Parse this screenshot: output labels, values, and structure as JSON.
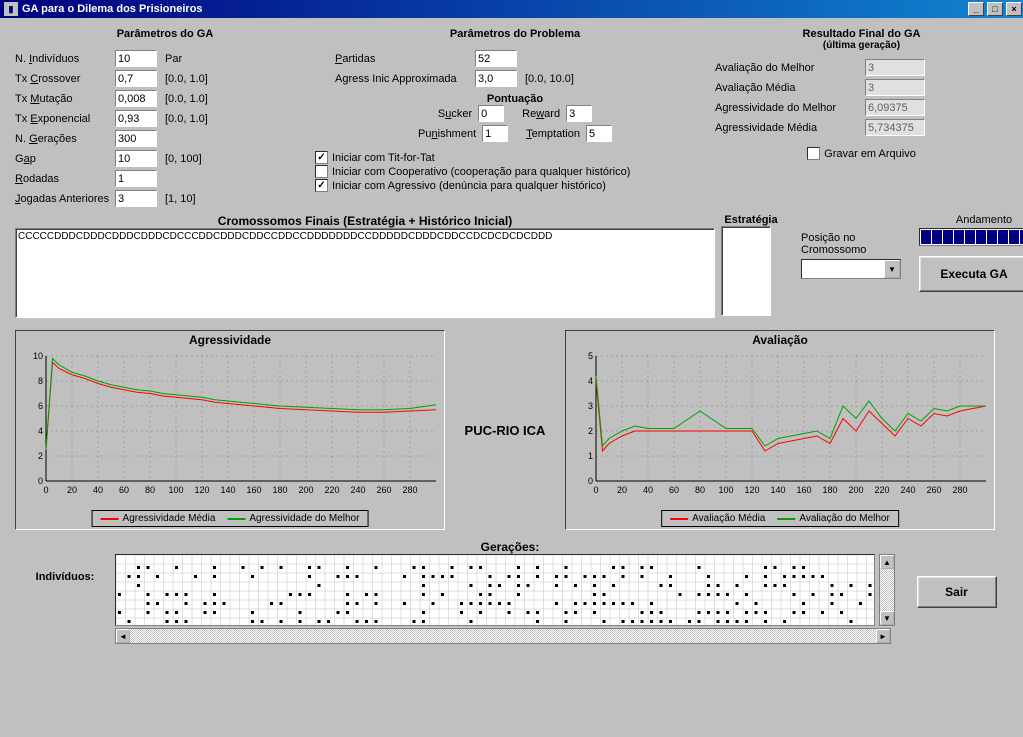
{
  "window": {
    "title": "GA para o Dilema dos Prisioneiros"
  },
  "ga_params": {
    "title": "Parâmetros do GA",
    "individuos_label": "N. Indivíduos",
    "individuos_value": "10",
    "individuos_hint": "Par",
    "crossover_label": "Tx Crossover",
    "crossover_value": "0,7",
    "crossover_range": "[0.0, 1.0]",
    "mutacao_label": "Tx Mutação",
    "mutacao_value": "0,008",
    "mutacao_range": "[0.0, 1.0]",
    "exp_label": "Tx Exponencial",
    "exp_value": "0,93",
    "exp_range": "[0.0, 1.0]",
    "geracoes_label": "N. Gerações",
    "geracoes_value": "300",
    "gap_label": "Gap",
    "gap_value": "10",
    "gap_range": "[0, 100]",
    "rodadas_label": "Rodadas",
    "rodadas_value": "1",
    "jogadas_label": "Jogadas Anteriores",
    "jogadas_value": "3",
    "jogadas_range": "[1, 10]"
  },
  "prob_params": {
    "title": "Parâmetros do Problema",
    "partidas_label": "Partidas",
    "partidas_value": "52",
    "agress_label": "Agress Inic Approximada",
    "agress_value": "3,0",
    "agress_range": "[0.0, 10.0]",
    "pontuacao_title": "Pontuação",
    "sucker_label": "Sucker",
    "sucker_value": "0",
    "reward_label": "Reward",
    "reward_value": "3",
    "punishment_label": "Punishment",
    "punishment_value": "1",
    "temptation_label": "Temptation",
    "temptation_value": "5",
    "titfortat_label": "Iniciar com Tit-for-Tat",
    "titfortat_checked": true,
    "coop_label": "Iniciar com Cooperativo (cooperação para qualquer histórico)",
    "coop_checked": false,
    "agressivo_label": "Iniciar com Agressivo (denúncia para qualquer histórico)",
    "agressivo_checked": true
  },
  "results": {
    "title": "Resultado Final do GA",
    "subtitle": "(última geração)",
    "aval_melhor_label": "Avaliação do Melhor",
    "aval_melhor_value": "3",
    "aval_media_label": "Avaliação Média",
    "aval_media_value": "3",
    "agress_melhor_label": "Agressividade do Melhor",
    "agress_melhor_value": "6,09375",
    "agress_media_label": "Agressividade Média",
    "agress_media_value": "5,734375",
    "gravar_label": "Gravar em Arquivo",
    "gravar_checked": false
  },
  "cromossomos": {
    "title": "Cromossomos Finais (Estratégia + Histórico Inicial)",
    "content": "CCCCCDDDCDDDCDDDCDDDCDCCCDDCDDDCDDCCDDCCDDDDDDDCCDDDDDCDDDCDDCCDCDCDCDCDDD",
    "estrategia_label": "Estratégia",
    "posicao_label": "Posição no Cromossomo",
    "andamento_label": "Andamento",
    "executa_label": "Executa GA"
  },
  "charts": {
    "center_label": "PUC-RIO ICA",
    "agress_title": "Agressividade",
    "agress_leg1": "Agressividade Média",
    "agress_leg2": "Agressividade do Melhor",
    "aval_title": "Avaliação",
    "aval_leg1": "Avaliação Média",
    "aval_leg2": "Avaliação do Melhor"
  },
  "bottom": {
    "geracoes_label": "Gerações:",
    "individuos_label": "Indivíduos:",
    "sair_label": "Sair"
  },
  "chart_data": [
    {
      "type": "line",
      "title": "Agressividade",
      "xlabel": "",
      "ylabel": "",
      "xlim": [
        0,
        300
      ],
      "ylim": [
        0,
        10
      ],
      "x_ticks": [
        0,
        20,
        40,
        60,
        80,
        100,
        120,
        140,
        160,
        180,
        200,
        220,
        240,
        260,
        280
      ],
      "y_ticks": [
        0,
        2,
        4,
        6,
        8,
        10
      ],
      "series": [
        {
          "name": "Agressividade Média",
          "color": "#ff0000",
          "x": [
            0,
            5,
            10,
            20,
            30,
            40,
            50,
            60,
            70,
            80,
            90,
            100,
            110,
            120,
            130,
            140,
            150,
            160,
            170,
            180,
            200,
            220,
            240,
            260,
            280,
            300
          ],
          "y": [
            2.5,
            9.5,
            9.0,
            8.5,
            8.2,
            7.8,
            7.5,
            7.3,
            7.1,
            7.0,
            6.8,
            6.7,
            6.6,
            6.5,
            6.3,
            6.2,
            6.1,
            6.0,
            5.9,
            5.8,
            5.7,
            5.6,
            5.5,
            5.5,
            5.6,
            5.7
          ]
        },
        {
          "name": "Agressividade do Melhor",
          "color": "#00a000",
          "x": [
            0,
            5,
            10,
            20,
            30,
            40,
            50,
            60,
            70,
            80,
            90,
            100,
            110,
            120,
            130,
            140,
            150,
            160,
            170,
            180,
            200,
            220,
            240,
            260,
            280,
            300
          ],
          "y": [
            2.5,
            9.8,
            9.3,
            8.7,
            8.4,
            8.0,
            7.7,
            7.5,
            7.3,
            7.2,
            7.0,
            6.9,
            6.8,
            6.7,
            6.5,
            6.4,
            6.3,
            6.2,
            6.1,
            6.0,
            5.9,
            5.8,
            5.7,
            5.7,
            5.8,
            6.1
          ]
        }
      ]
    },
    {
      "type": "line",
      "title": "Avaliação",
      "xlabel": "",
      "ylabel": "",
      "xlim": [
        0,
        300
      ],
      "ylim": [
        0,
        5
      ],
      "x_ticks": [
        0,
        20,
        40,
        60,
        80,
        100,
        120,
        140,
        160,
        180,
        200,
        220,
        240,
        260,
        280
      ],
      "y_ticks": [
        0,
        1,
        2,
        3,
        4,
        5
      ],
      "series": [
        {
          "name": "Avaliação Média",
          "color": "#ff0000",
          "x": [
            0,
            5,
            10,
            20,
            30,
            40,
            50,
            60,
            80,
            100,
            120,
            130,
            140,
            150,
            160,
            170,
            180,
            190,
            200,
            210,
            220,
            230,
            240,
            250,
            260,
            270,
            280,
            290,
            300
          ],
          "y": [
            4.0,
            1.2,
            1.5,
            1.8,
            2.0,
            2.0,
            2.0,
            2.0,
            2.0,
            2.0,
            2.0,
            1.2,
            1.5,
            1.6,
            1.7,
            1.8,
            1.5,
            2.5,
            2.0,
            2.8,
            2.3,
            1.8,
            2.5,
            2.2,
            2.7,
            2.6,
            2.8,
            2.9,
            3.0
          ]
        },
        {
          "name": "Avaliação do Melhor",
          "color": "#00a000",
          "x": [
            0,
            5,
            10,
            20,
            30,
            40,
            50,
            60,
            80,
            100,
            120,
            130,
            140,
            150,
            160,
            170,
            180,
            190,
            200,
            210,
            220,
            230,
            240,
            250,
            260,
            270,
            280,
            290,
            300
          ],
          "y": [
            4.2,
            1.4,
            1.7,
            2.0,
            2.2,
            2.1,
            2.1,
            2.1,
            2.8,
            2.1,
            2.1,
            1.4,
            1.7,
            1.8,
            1.9,
            2.0,
            1.7,
            3.0,
            2.5,
            3.2,
            2.5,
            2.0,
            2.7,
            2.4,
            2.9,
            2.8,
            3.0,
            3.0,
            3.0
          ]
        }
      ]
    }
  ]
}
